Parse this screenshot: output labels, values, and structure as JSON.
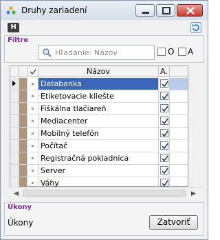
{
  "window": {
    "title": "Druhy zariadení",
    "help_button": "H"
  },
  "filters": {
    "section_label": "Filtre",
    "search_placeholder": "Hľadanie: Názov",
    "option_o": "O",
    "option_a": "A"
  },
  "grid": {
    "header_name": "Názov",
    "header_active": "A.",
    "rows": [
      {
        "name": "Databanka",
        "active": true,
        "selected": true
      },
      {
        "name": "Etiketovacie kliešte",
        "active": true,
        "selected": false
      },
      {
        "name": "Fiškálna tlačiareň",
        "active": true,
        "selected": false
      },
      {
        "name": "Mediacenter",
        "active": true,
        "selected": false
      },
      {
        "name": "Mobilný telefón",
        "active": true,
        "selected": false
      },
      {
        "name": "Počítač",
        "active": true,
        "selected": false
      },
      {
        "name": "Registračná pokladnica",
        "active": true,
        "selected": false
      },
      {
        "name": "Server",
        "active": true,
        "selected": false
      },
      {
        "name": "Váhy",
        "active": true,
        "selected": false
      }
    ]
  },
  "bottom": {
    "section_label": "Úkony",
    "caption": "Úkony",
    "close_label": "Zatvoriť"
  },
  "colors": {
    "selection": "#3e66b6",
    "row_stripe": "#ad977c",
    "section_label": "#7a2a9a"
  }
}
